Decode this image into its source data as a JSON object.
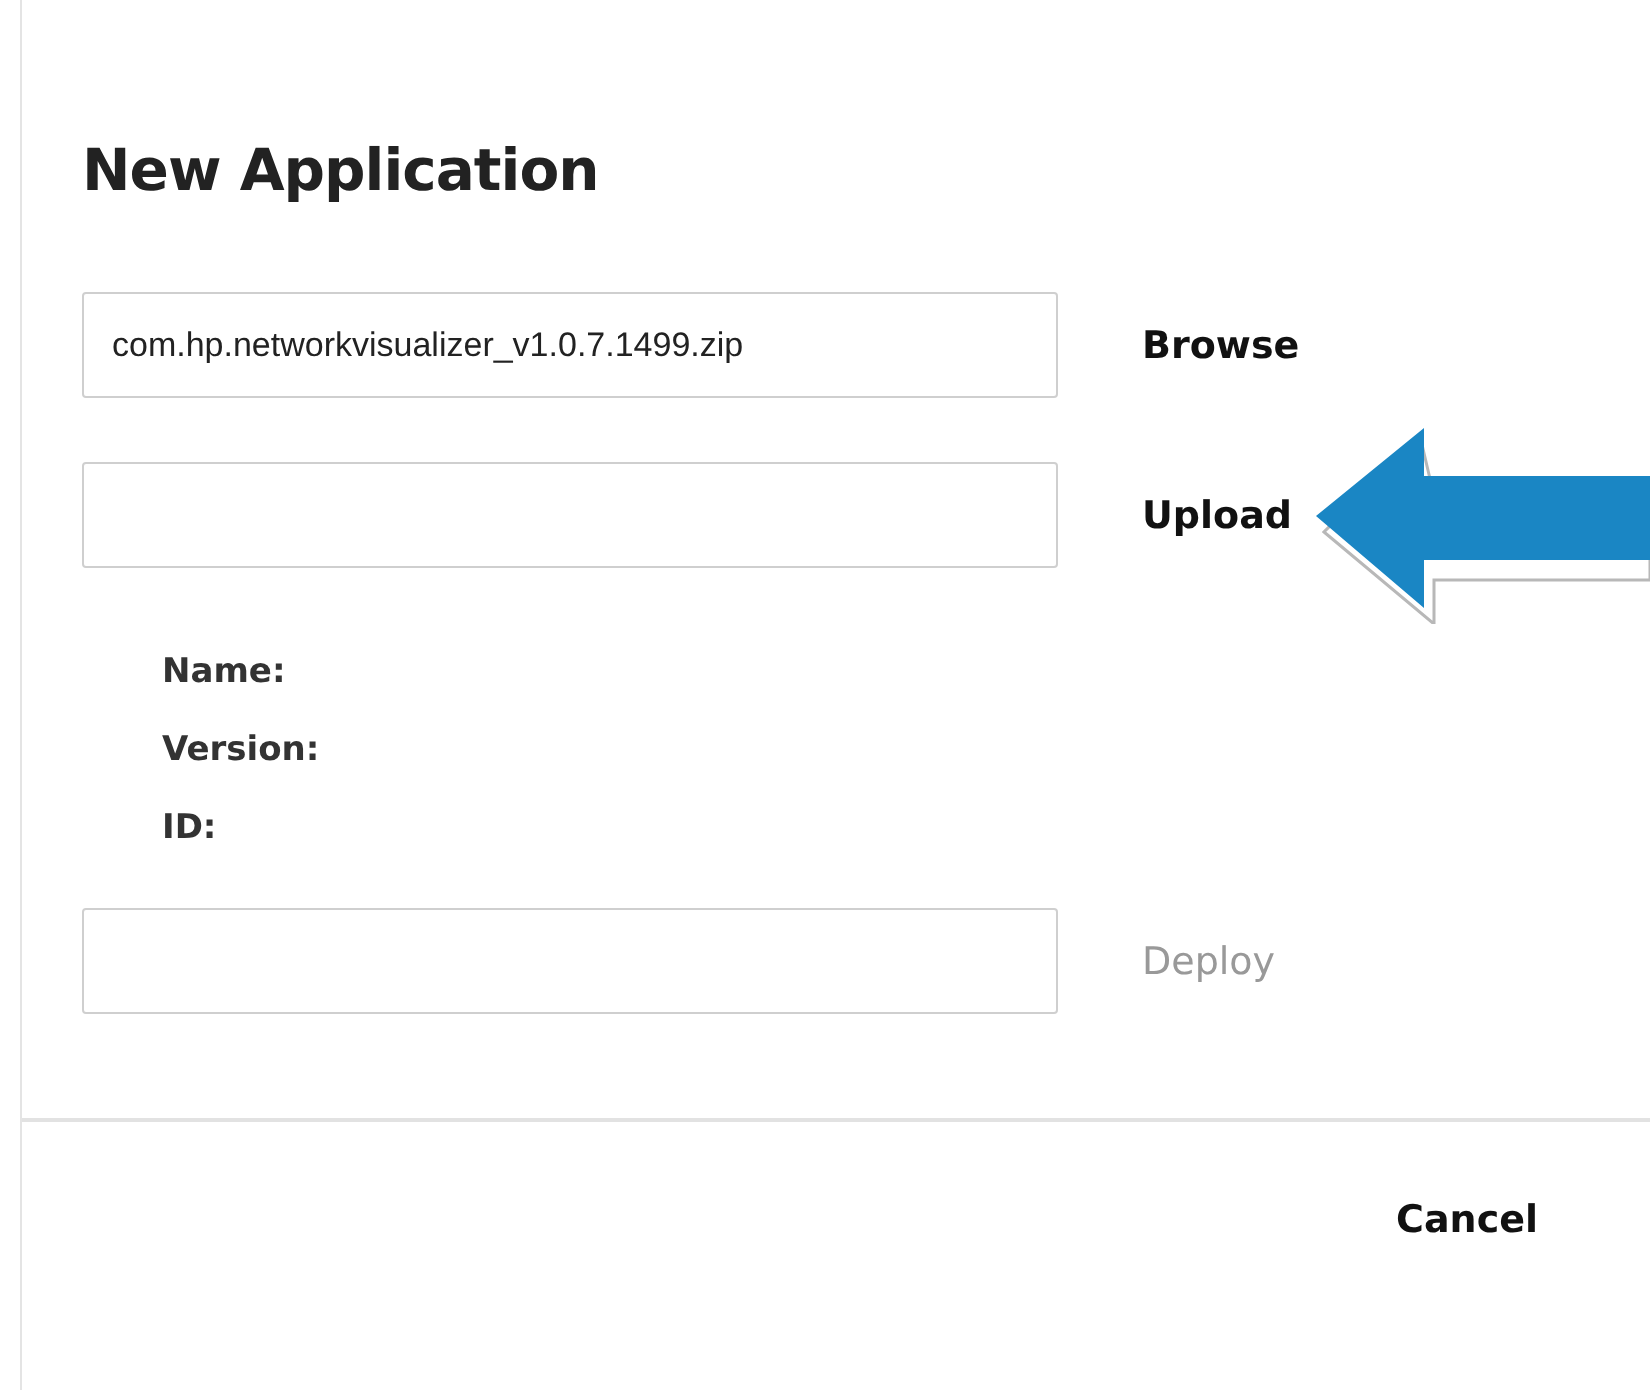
{
  "dialog": {
    "title": "New Application",
    "file_field": {
      "value": "com.hp.networkvisualizer_v1.0.7.1499.zip"
    },
    "browse_button": {
      "label": "Browse",
      "disabled": false
    },
    "upload_button": {
      "label": "Upload",
      "disabled": false
    },
    "info_labels": [
      "Name:",
      "Version:",
      "ID:"
    ],
    "deploy_button": {
      "label": "Deploy",
      "disabled": true
    },
    "cancel_button": {
      "label": "Cancel"
    }
  }
}
